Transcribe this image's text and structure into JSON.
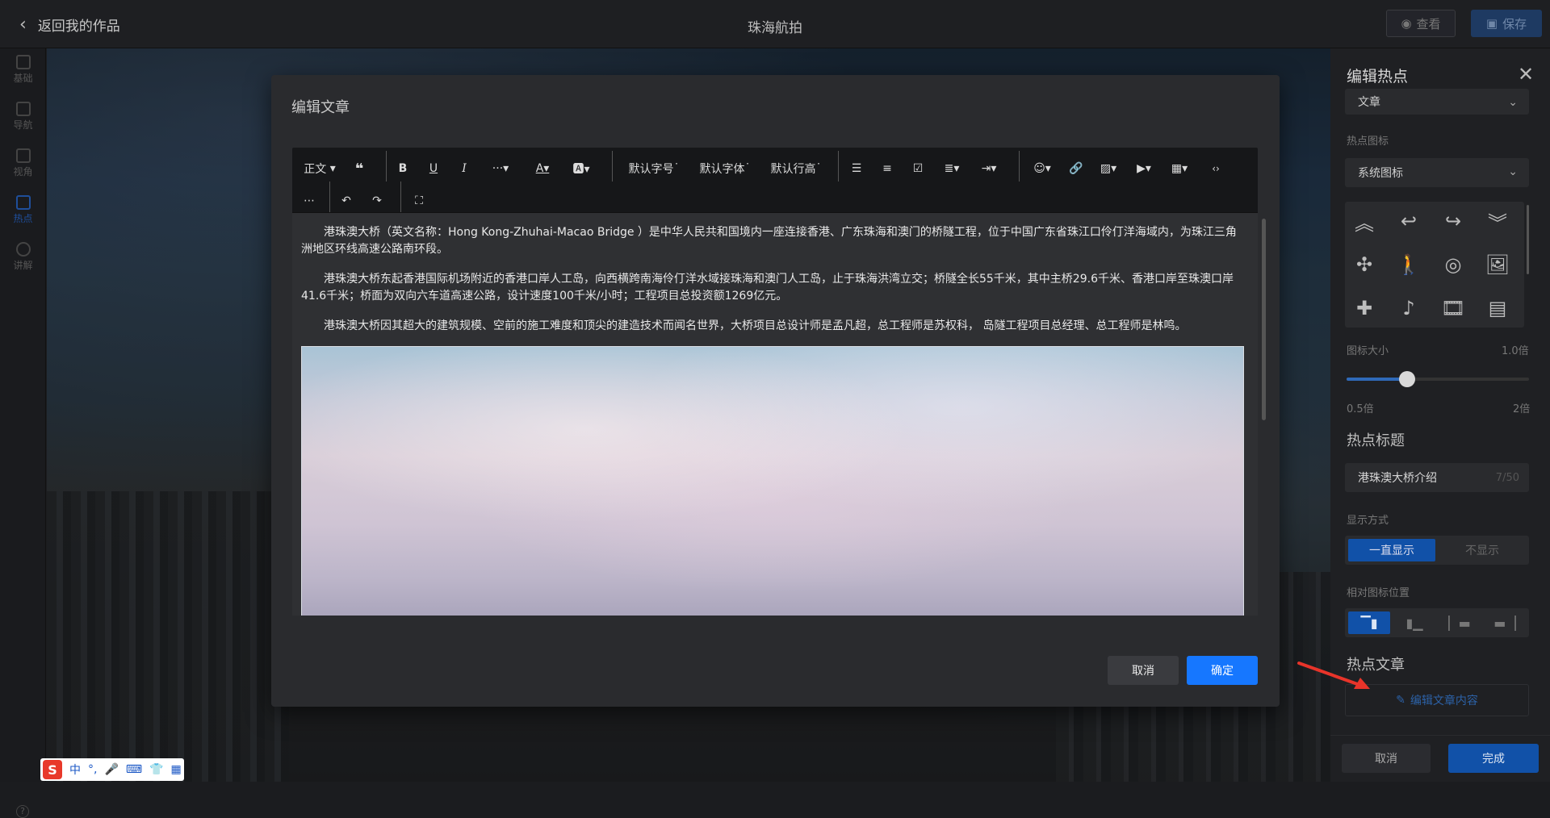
{
  "header": {
    "back_label": "返回我的作品",
    "title": "珠海航拍",
    "view_label": "查看",
    "save_label": "保存"
  },
  "leftnav": {
    "items": [
      {
        "label": "基础",
        "icon": "document-icon"
      },
      {
        "label": "导航",
        "icon": "grid-icon"
      },
      {
        "label": "视角",
        "icon": "frame-icon"
      },
      {
        "label": "热点",
        "icon": "hotspot-icon",
        "active": true
      },
      {
        "label": "讲解",
        "icon": "headset-icon"
      }
    ],
    "help_label": "?"
  },
  "modal": {
    "title": "编辑文章",
    "toolbar": {
      "paragraph": "正文",
      "font_size": "默认字号",
      "font_family": "默认字体",
      "line_height": "默认行高"
    },
    "paragraphs": [
      "港珠澳大桥（英文名称：Hong Kong-Zhuhai-Macao Bridge ）是中华人民共和国境内一座连接香港、广东珠海和澳门的桥隧工程，位于中国广东省珠江口伶仃洋海域内，为珠江三角洲地区环线高速公路南环段。",
      "港珠澳大桥东起香港国际机场附近的香港口岸人工岛，向西横跨南海伶仃洋水域接珠海和澳门人工岛，止于珠海洪湾立交；桥隧全长55千米，其中主桥29.6千米、香港口岸至珠澳口岸41.6千米；桥面为双向六车道高速公路，设计速度100千米/小时；工程项目总投资额1269亿元。",
      "港珠澳大桥因其超大的建筑规模、空前的施工难度和顶尖的建造技术而闻名世界，大桥项目总设计师是孟凡超，总工程师是苏权科， 岛隧工程项目总经理、总工程师是林鸣。"
    ],
    "cancel_label": "取消",
    "ok_label": "确定"
  },
  "right_panel": {
    "title": "编辑热点",
    "type_value": "文章",
    "icon_label": "热点图标",
    "icon_source": "系统图标",
    "icons": [
      "chevron-up-double-icon",
      "reply-icon",
      "forward-icon",
      "chevron-down-double-icon",
      "drone-icon",
      "walk-icon",
      "circle-icon",
      "image-icon",
      "bandage-icon",
      "music-note-icon",
      "film-icon",
      "article-icon"
    ],
    "size_label": "图标大小",
    "size_value": "1.0倍",
    "size_min": "0.5倍",
    "size_max": "2倍",
    "size_fraction": 0.33,
    "hotspot_title_heading": "热点标题",
    "hotspot_title_value": "港珠澳大桥介绍",
    "hotspot_title_count": "7/50",
    "display_label": "显示方式",
    "display_on": "一直显示",
    "display_off": "不显示",
    "position_label": "相对图标位置",
    "article_heading": "热点文章",
    "edit_article_label": "编辑文章内容",
    "cancel_label": "取消",
    "done_label": "完成"
  },
  "ime": {
    "logo": "S",
    "lang": "中",
    "punct": "°,"
  },
  "colors": {
    "accent": "#1677ff",
    "panel_active": "#1151a8",
    "arrow": "#e8342a"
  }
}
